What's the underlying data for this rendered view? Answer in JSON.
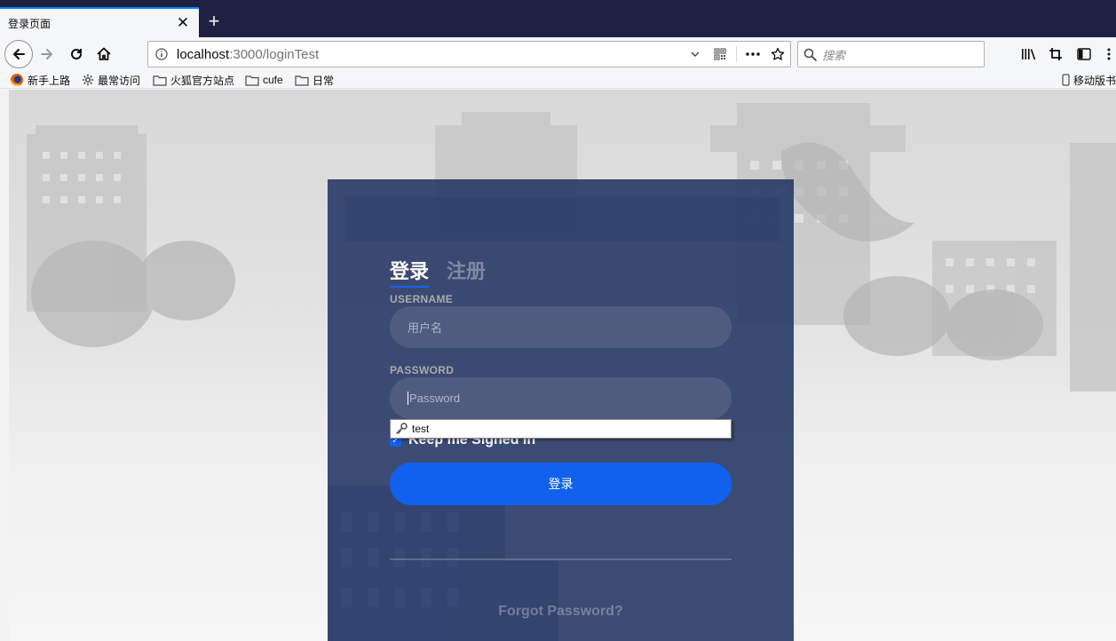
{
  "browser": {
    "tab_title": "登录页面",
    "tab_close": "✕",
    "new_tab": "+",
    "url_host": "localhost",
    "url_rest": ":3000/loginTest",
    "search_placeholder": "搜索",
    "bookmarks": [
      "新手上路",
      "最常访问",
      "火狐官方站点",
      "cufe",
      "日常"
    ],
    "mobile_bookmarks": "移动版书"
  },
  "login": {
    "tab_login": "登录",
    "tab_signup": "注册",
    "username_label": "USERNAME",
    "username_placeholder": "用户名",
    "password_label": "PASSWORD",
    "password_placeholder": "Password",
    "keep_signed_in": "Keep me Signed in",
    "keep_signed_in_checked": true,
    "submit_label": "登录",
    "forgot_password": "Forgot Password?",
    "autocomplete_option": "test"
  },
  "colors": {
    "accent": "#1161ee",
    "card": "#283965",
    "tabstrip": "#1f2143",
    "tab_highlight": "#0a84ff"
  }
}
